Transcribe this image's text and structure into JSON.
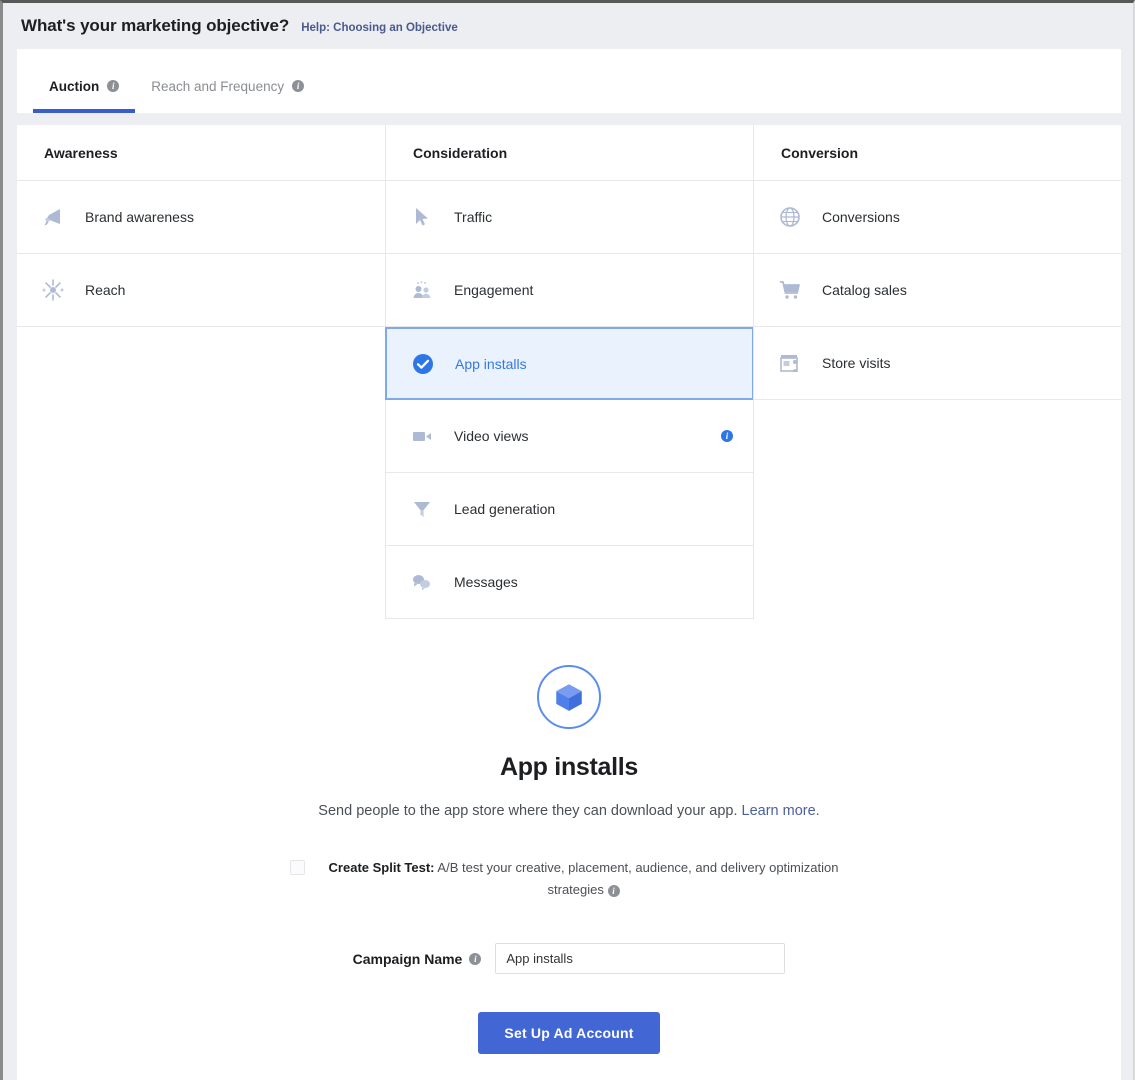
{
  "header": {
    "title": "What's your marketing objective?",
    "help_link": "Help: Choosing an Objective"
  },
  "tabs": [
    {
      "label": "Auction",
      "active": true,
      "info_icon": "info-icon"
    },
    {
      "label": "Reach and Frequency",
      "active": false,
      "info_icon": "info-icon"
    }
  ],
  "columns": [
    {
      "heading": "Awareness",
      "items": [
        {
          "label": "Brand awareness",
          "icon": "megaphone-icon",
          "selected": false,
          "info": false
        },
        {
          "label": "Reach",
          "icon": "starburst-icon",
          "selected": false,
          "info": false
        }
      ]
    },
    {
      "heading": "Consideration",
      "items": [
        {
          "label": "Traffic",
          "icon": "cursor-arrow-icon",
          "selected": false,
          "info": false
        },
        {
          "label": "Engagement",
          "icon": "people-icon",
          "selected": false,
          "info": false
        },
        {
          "label": "App installs",
          "icon": "check-circle-icon",
          "selected": true,
          "info": false
        },
        {
          "label": "Video views",
          "icon": "video-camera-icon",
          "selected": false,
          "info": true
        },
        {
          "label": "Lead generation",
          "icon": "funnel-icon",
          "selected": false,
          "info": false
        },
        {
          "label": "Messages",
          "icon": "chat-bubbles-icon",
          "selected": false,
          "info": false
        }
      ]
    },
    {
      "heading": "Conversion",
      "items": [
        {
          "label": "Conversions",
          "icon": "globe-icon",
          "selected": false,
          "info": false
        },
        {
          "label": "Catalog sales",
          "icon": "shopping-cart-icon",
          "selected": false,
          "info": false
        },
        {
          "label": "Store visits",
          "icon": "storefront-icon",
          "selected": false,
          "info": false
        }
      ]
    }
  ],
  "detail": {
    "badge_icon": "cube-box-icon",
    "title": "App installs",
    "description": "Send people to the app store where they can download your app.",
    "learn_more": "Learn more.",
    "split_test": {
      "checked": false,
      "label": "Create Split Test:",
      "text": "A/B test your creative, placement, audience, and delivery optimization strategies",
      "info_icon": "info-icon"
    },
    "campaign": {
      "label": "Campaign Name",
      "info_icon": "info-icon",
      "value": "App installs",
      "placeholder": "Campaign Name"
    },
    "cta": "Set Up Ad Account"
  },
  "colors": {
    "accent_blue": "#4267d4",
    "selected_bg": "#eaf2fd",
    "selected_border": "#7fa9e8",
    "icon_grey": "#9fb0d0",
    "tab_underline": "#3b5dc9"
  }
}
